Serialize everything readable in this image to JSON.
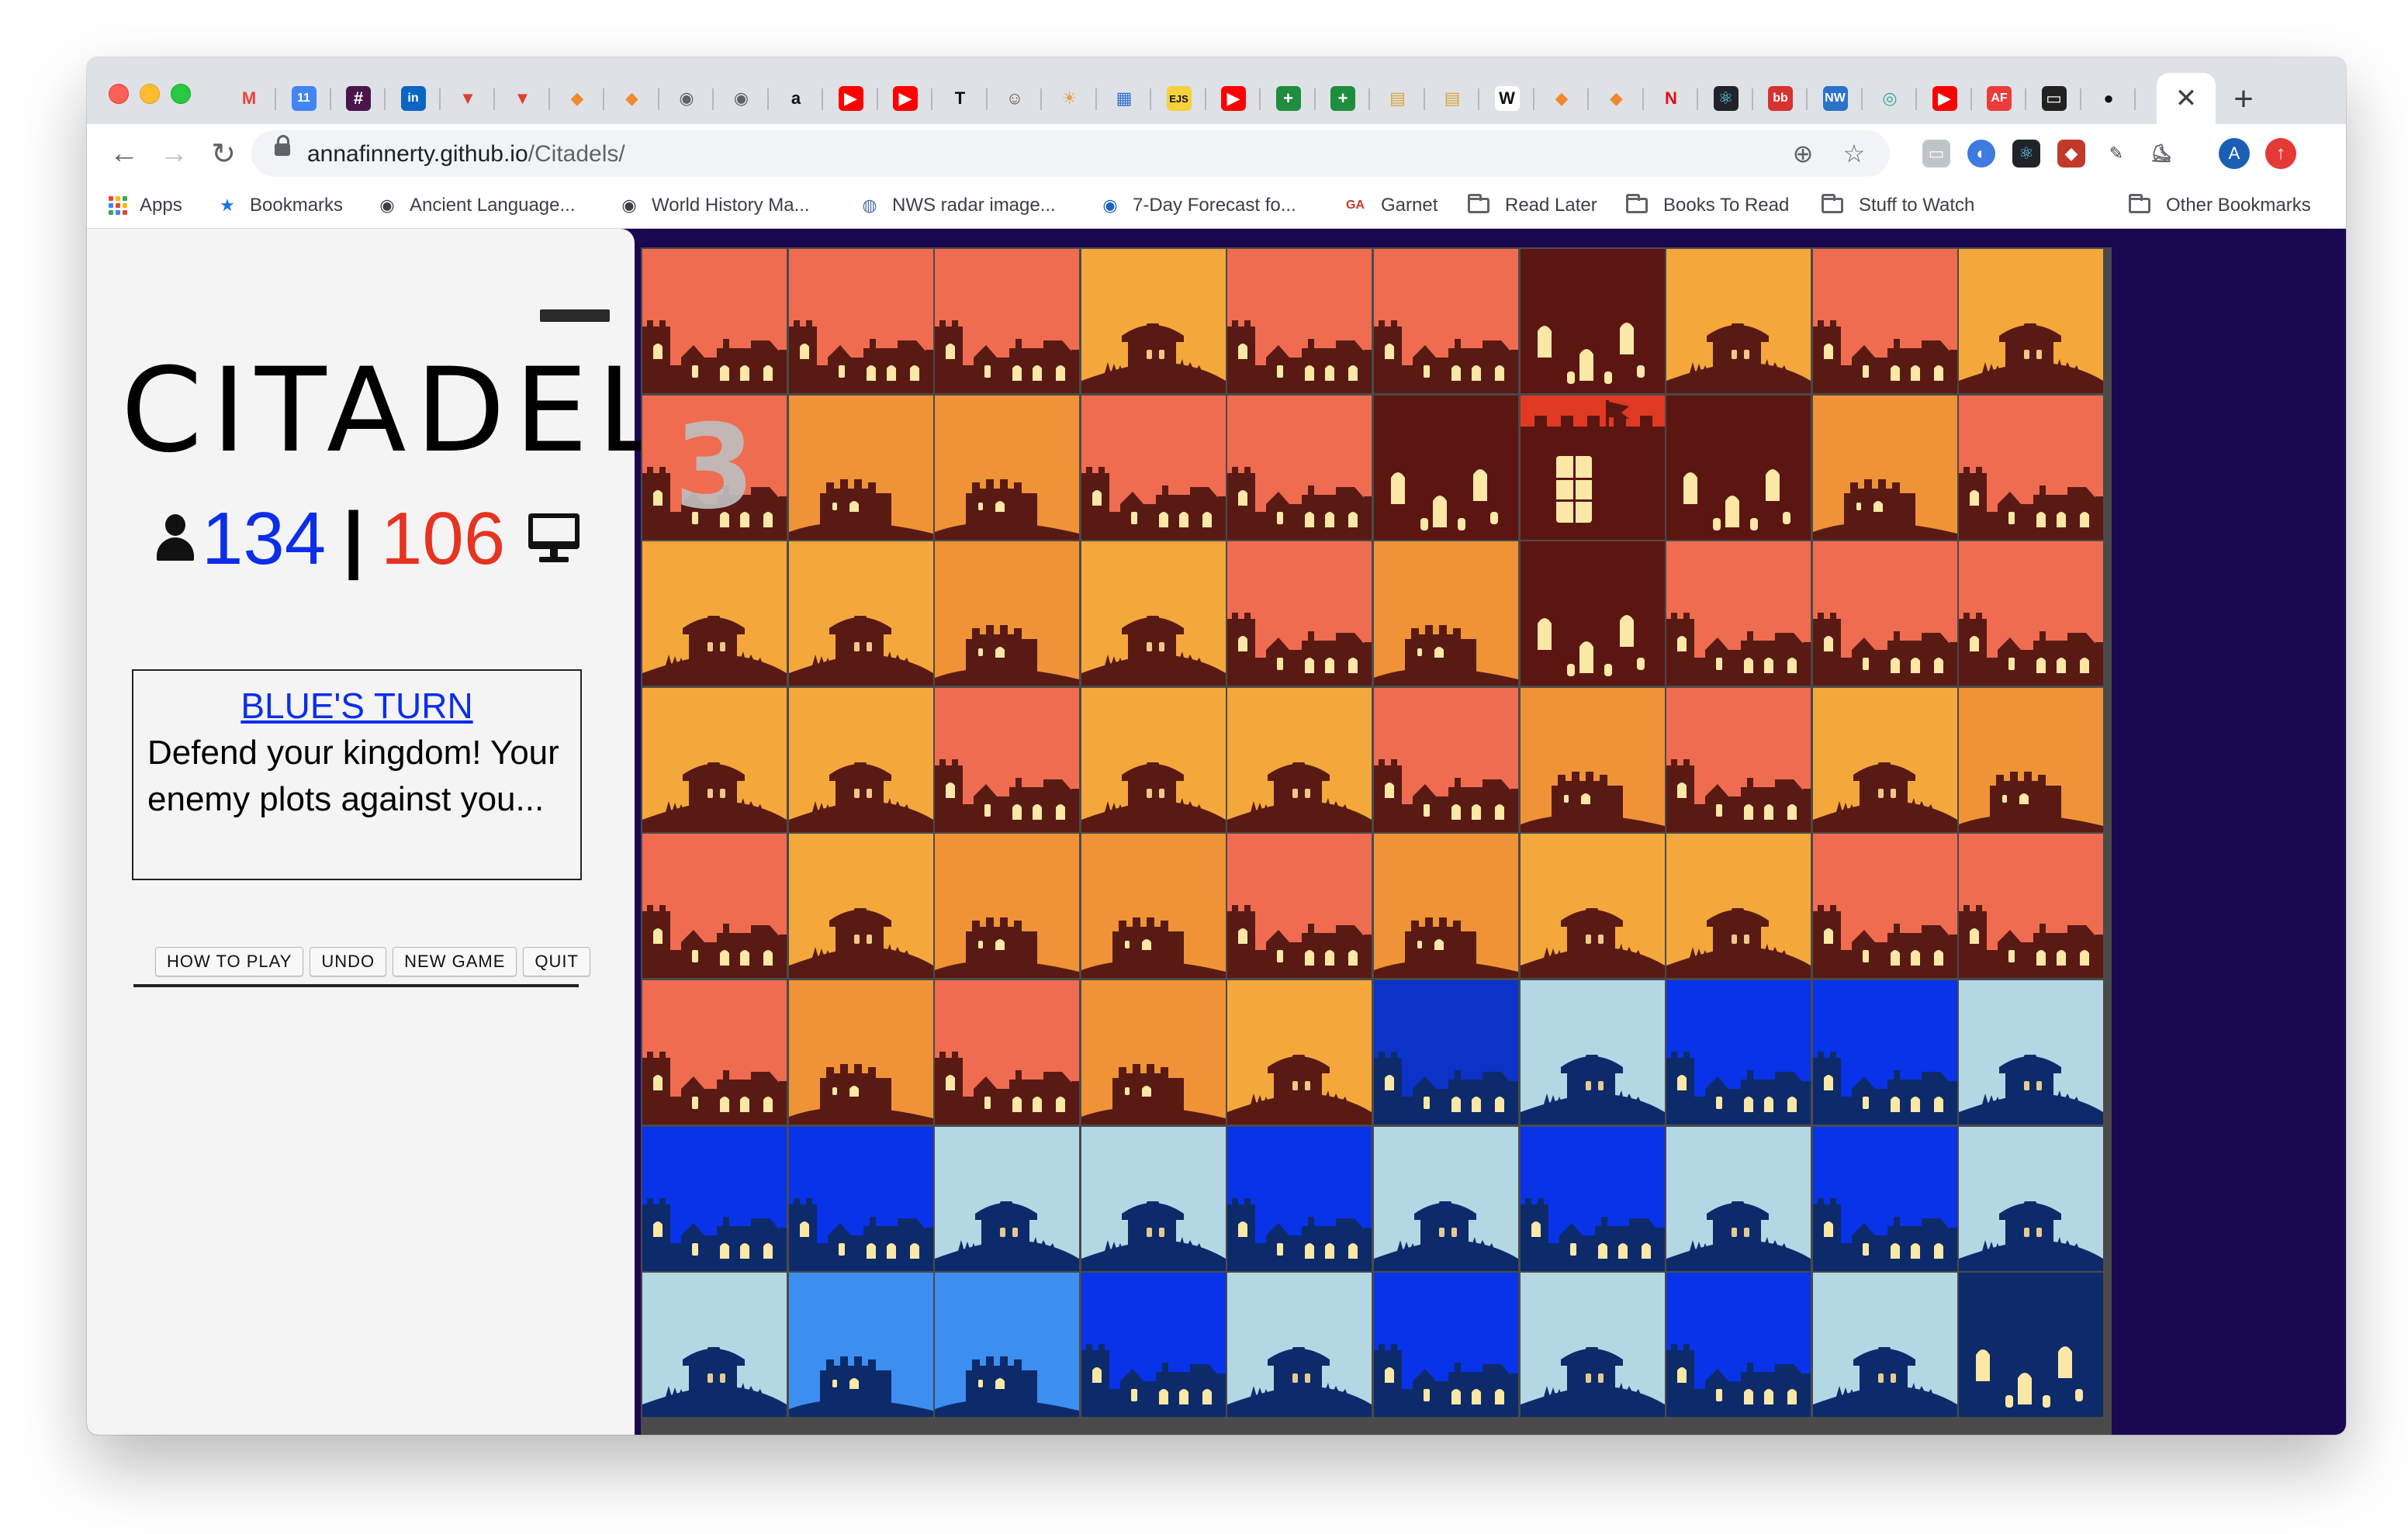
{
  "browser": {
    "tabs": [
      {
        "icon": "gmail-icon",
        "glyph": "M",
        "color": "#ea4335",
        "bg": "transparent"
      },
      {
        "icon": "calendar-icon",
        "glyph": "11",
        "color": "#ffffff",
        "bg": "#4285f4"
      },
      {
        "icon": "slack-icon",
        "glyph": "#",
        "color": "#ffffff",
        "bg": "#4a154b"
      },
      {
        "icon": "linkedin-icon",
        "glyph": "in",
        "color": "#ffffff",
        "bg": "#0a66c2"
      },
      {
        "icon": "todoist-icon",
        "glyph": "▼",
        "color": "#db4035",
        "bg": "transparent"
      },
      {
        "icon": "todoist-icon",
        "glyph": "▼",
        "color": "#db4035",
        "bg": "transparent"
      },
      {
        "icon": "box-icon",
        "glyph": "◆",
        "color": "#f0882e",
        "bg": "transparent"
      },
      {
        "icon": "box-icon",
        "glyph": "◆",
        "color": "#f0882e",
        "bg": "transparent"
      },
      {
        "icon": "globe-icon",
        "glyph": "◉",
        "color": "#5f6368",
        "bg": "transparent"
      },
      {
        "icon": "globe-icon",
        "glyph": "◉",
        "color": "#5f6368",
        "bg": "transparent"
      },
      {
        "icon": "amazon-icon",
        "glyph": "a",
        "color": "#111111",
        "bg": "transparent"
      },
      {
        "icon": "youtube-icon",
        "glyph": "▶",
        "color": "#ffffff",
        "bg": "#ff0000"
      },
      {
        "icon": "youtube-icon",
        "glyph": "▶",
        "color": "#ffffff",
        "bg": "#ff0000"
      },
      {
        "icon": "nytimes-icon",
        "glyph": "T",
        "color": "#111111",
        "bg": "transparent"
      },
      {
        "icon": "meerkat-icon",
        "glyph": "☺",
        "color": "#6b4a2a",
        "bg": "transparent"
      },
      {
        "icon": "sun-icon",
        "glyph": "☀",
        "color": "#e0a040",
        "bg": "transparent"
      },
      {
        "icon": "dashboard-icon",
        "glyph": "▦",
        "color": "#2d6fd6",
        "bg": "transparent"
      },
      {
        "icon": "ejs-icon",
        "glyph": "EJS",
        "color": "#111111",
        "bg": "#f5d13b"
      },
      {
        "icon": "youtube-icon",
        "glyph": "▶",
        "color": "#ffffff",
        "bg": "#ff0000"
      },
      {
        "icon": "sheets-icon",
        "glyph": "+",
        "color": "#ffffff",
        "bg": "#1e8e3e"
      },
      {
        "icon": "sheets-icon",
        "glyph": "+",
        "color": "#ffffff",
        "bg": "#1e8e3e"
      },
      {
        "icon": "book-icon",
        "glyph": "▤",
        "color": "#d9a534",
        "bg": "transparent"
      },
      {
        "icon": "book-icon",
        "glyph": "▤",
        "color": "#d9a534",
        "bg": "transparent"
      },
      {
        "icon": "wikipedia-icon",
        "glyph": "W",
        "color": "#111111",
        "bg": "#ffffff"
      },
      {
        "icon": "box-icon",
        "glyph": "◆",
        "color": "#f0882e",
        "bg": "transparent"
      },
      {
        "icon": "box-icon",
        "glyph": "◆",
        "color": "#f0882e",
        "bg": "transparent"
      },
      {
        "icon": "netflix-icon",
        "glyph": "N",
        "color": "#e50914",
        "bg": "transparent"
      },
      {
        "icon": "react-icon",
        "glyph": "⚛",
        "color": "#61dafb",
        "bg": "#20232a"
      },
      {
        "icon": "bb-icon",
        "glyph": "bb",
        "color": "#ffffff",
        "bg": "#d6322f"
      },
      {
        "icon": "nw-icon",
        "glyph": "NW",
        "color": "#ffffff",
        "bg": "#2a73c9"
      },
      {
        "icon": "eye-icon",
        "glyph": "◎",
        "color": "#3aa6a0",
        "bg": "transparent"
      },
      {
        "icon": "youtube-icon",
        "glyph": "▶",
        "color": "#ffffff",
        "bg": "#ff0000"
      },
      {
        "icon": "af-icon",
        "glyph": "AF",
        "color": "#ffffff",
        "bg": "#ec3b3b"
      },
      {
        "icon": "terminal-icon",
        "glyph": "▭",
        "color": "#ffffff",
        "bg": "#222222"
      },
      {
        "icon": "github-icon",
        "glyph": "●",
        "color": "#111111",
        "bg": "transparent"
      }
    ],
    "url": {
      "host": "annafinnerty.github.io",
      "path": "/Citadels/"
    },
    "bookmarks": [
      {
        "label": "Apps",
        "icon": "apps-grid-icon"
      },
      {
        "label": "Bookmarks",
        "icon": "star-icon"
      },
      {
        "label": "Ancient Language...",
        "icon": "globe-icon"
      },
      {
        "label": "World History Ma...",
        "icon": "globe-icon"
      },
      {
        "label": "NWS radar image...",
        "icon": "nws-icon"
      },
      {
        "label": "7-Day Forecast fo...",
        "icon": "noaa-icon"
      },
      {
        "label": "Garnet",
        "icon": "ga-icon"
      },
      {
        "label": "Read Later",
        "icon": "folder-icon"
      },
      {
        "label": "Books To Read",
        "icon": "folder-icon"
      },
      {
        "label": "Stuff to Watch",
        "icon": "folder-icon"
      },
      {
        "label": "Other Bookmarks",
        "icon": "folder-icon"
      }
    ],
    "ga_glyph": "GA",
    "profile_initial": "A"
  },
  "game": {
    "title": "CITADELS",
    "score_blue": "134",
    "score_separator": "|",
    "score_red": "106",
    "turn_title": "BLUE'S TURN",
    "turn_message": "Defend your kingdom! Your enemy plots against you...",
    "buttons": [
      "HOW TO PLAY",
      "UNDO",
      "NEW GAME",
      "QUIT"
    ],
    "selected_cell_number": "3",
    "colors": {
      "red_bg": "#ef6c50",
      "orange_bg": "#ef9336",
      "amber_bg": "#f4a83c",
      "red_silhouette": "#5a1a14",
      "maroon_bg": "#7b1410",
      "maroon_bright_bg": "#e03a22",
      "navy_bg": "#0b33c7",
      "blue_bg": "#0833e8",
      "lightblue_bg": "#b4d7e4",
      "skyblue_bg": "#3c8ef0",
      "blue_silhouette": "#0d2b6b",
      "purple_bg": "#772370",
      "window_light": "#fbe7a6",
      "board_bg": "#1a0850"
    },
    "board": [
      [
        "red_castle",
        "red_castle",
        "red_castle",
        "amber_hut",
        "red_castle",
        "red_castle",
        "maroon_fortress",
        "amber_hut",
        "red_castle",
        "amber_hut"
      ],
      [
        "red_castle",
        "orange_tower",
        "orange_tower",
        "red_castle",
        "red_castle",
        "maroon_fortress",
        "maroon_keep",
        "maroon_fortress",
        "orange_tower",
        "red_castle"
      ],
      [
        "amber_hut",
        "amber_hut",
        "orange_tower",
        "amber_hut",
        "red_castle",
        "orange_tower",
        "maroon_fortress",
        "red_castle",
        "red_castle",
        "red_castle"
      ],
      [
        "amber_hut",
        "amber_hut",
        "red_castle",
        "amber_hut",
        "amber_hut",
        "red_castle",
        "orange_tower",
        "red_castle",
        "amber_hut",
        "orange_tower"
      ],
      [
        "red_castle",
        "amber_hut",
        "orange_tower",
        "orange_tower",
        "red_castle",
        "orange_tower",
        "amber_hut",
        "amber_hut",
        "red_castle",
        "red_castle"
      ],
      [
        "red_castle",
        "orange_tower",
        "red_castle",
        "orange_tower",
        "amber_hut",
        "navy_castle",
        "lightblue_hut",
        "blue_castle",
        "blue_castle",
        "lightblue_hut"
      ],
      [
        "blue_castle",
        "blue_castle",
        "lightblue_hut",
        "lightblue_hut",
        "blue_castle",
        "lightblue_hut",
        "blue_castle",
        "lightblue_hut",
        "blue_castle",
        "lightblue_hut"
      ],
      [
        "lightblue_hut",
        "skyblue_tower",
        "skyblue_tower",
        "blue_castle",
        "lightblue_hut",
        "blue_castle",
        "lightblue_hut",
        "blue_castle",
        "lightblue_hut",
        "purple_fortress"
      ]
    ],
    "selected_cell": {
      "row": 1,
      "col": 0
    }
  }
}
